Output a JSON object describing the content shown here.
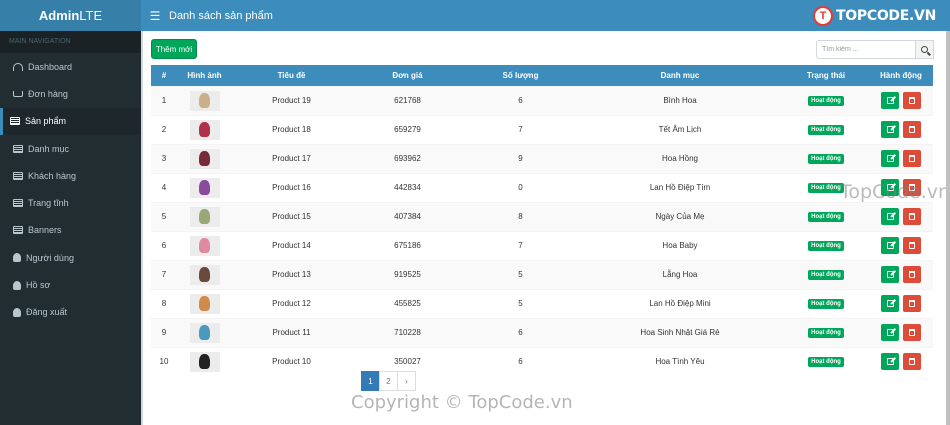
{
  "app": {
    "logo_bold": "Admin",
    "logo_rest": "LTE"
  },
  "header": {
    "title": "Danh sách sản phẩm",
    "brand_mark": "T",
    "brand_text": "TOPCODE.VN"
  },
  "sidebar": {
    "header": "MAIN NAVIGATION",
    "items": [
      {
        "label": "Dashboard",
        "icon": "dashboard-icon"
      },
      {
        "label": "Đơn hàng",
        "icon": "cart-icon"
      },
      {
        "label": "Sản phẩm",
        "icon": "list-icon"
      },
      {
        "label": "Danh mục",
        "icon": "list-icon"
      },
      {
        "label": "Khách hàng",
        "icon": "list-icon"
      },
      {
        "label": "Trang tĩnh",
        "icon": "list-icon"
      },
      {
        "label": "Banners",
        "icon": "list-icon"
      },
      {
        "label": "Người dùng",
        "icon": "user-icon"
      },
      {
        "label": "Hồ sơ",
        "icon": "user-icon"
      },
      {
        "label": "Đăng xuất",
        "icon": "user-icon"
      }
    ]
  },
  "toolbar": {
    "add_label": "Thêm mới",
    "search_placeholder": "Tìm kiếm ..."
  },
  "table": {
    "headers": [
      "#",
      "Hình ảnh",
      "Tiêu đề",
      "Đơn giá",
      "Số lượng",
      "Danh mục",
      "Trạng thái",
      "Hành động"
    ],
    "rows": [
      {
        "no": "1",
        "title": "Product 19",
        "price": "621768",
        "qty": "6",
        "category": "Bình Hoa",
        "status": "Hoạt động",
        "thumb": "#c9b08a"
      },
      {
        "no": "2",
        "title": "Product 18",
        "price": "659279",
        "qty": "7",
        "category": "Tết Âm Lịch",
        "status": "Hoạt động",
        "thumb": "#b0324a"
      },
      {
        "no": "3",
        "title": "Product 17",
        "price": "693962",
        "qty": "9",
        "category": "Hoa Hồng",
        "status": "Hoạt động",
        "thumb": "#7a2a36"
      },
      {
        "no": "4",
        "title": "Product 16",
        "price": "442834",
        "qty": "0",
        "category": "Lan Hồ Điệp Tím",
        "status": "Hoạt động",
        "thumb": "#8a4a9e"
      },
      {
        "no": "5",
        "title": "Product 15",
        "price": "407384",
        "qty": "8",
        "category": "Ngày Của Mẹ",
        "status": "Hoạt động",
        "thumb": "#9aa878"
      },
      {
        "no": "6",
        "title": "Product 14",
        "price": "675186",
        "qty": "7",
        "category": "Hoa Baby",
        "status": "Hoạt động",
        "thumb": "#e08aa2"
      },
      {
        "no": "7",
        "title": "Product 13",
        "price": "919525",
        "qty": "5",
        "category": "Lẵng Hoa",
        "status": "Hoạt động",
        "thumb": "#6a4a3a"
      },
      {
        "no": "8",
        "title": "Product 12",
        "price": "455825",
        "qty": "5",
        "category": "Lan Hồ Điệp Mini",
        "status": "Hoạt động",
        "thumb": "#d08a4a"
      },
      {
        "no": "9",
        "title": "Product 11",
        "price": "710228",
        "qty": "6",
        "category": "Hoa Sinh Nhật Giá Rẻ",
        "status": "Hoạt động",
        "thumb": "#4a9ac0"
      },
      {
        "no": "10",
        "title": "Product 10",
        "price": "350027",
        "qty": "6",
        "category": "Hoa Tình Yêu",
        "status": "Hoạt động",
        "thumb": "#222222"
      }
    ]
  },
  "pagination": {
    "pages": [
      "1",
      "2",
      "›"
    ],
    "current": "1"
  },
  "watermarks": {
    "mid": "TopCode.vn",
    "bottom": "Copyright © TopCode.vn"
  }
}
